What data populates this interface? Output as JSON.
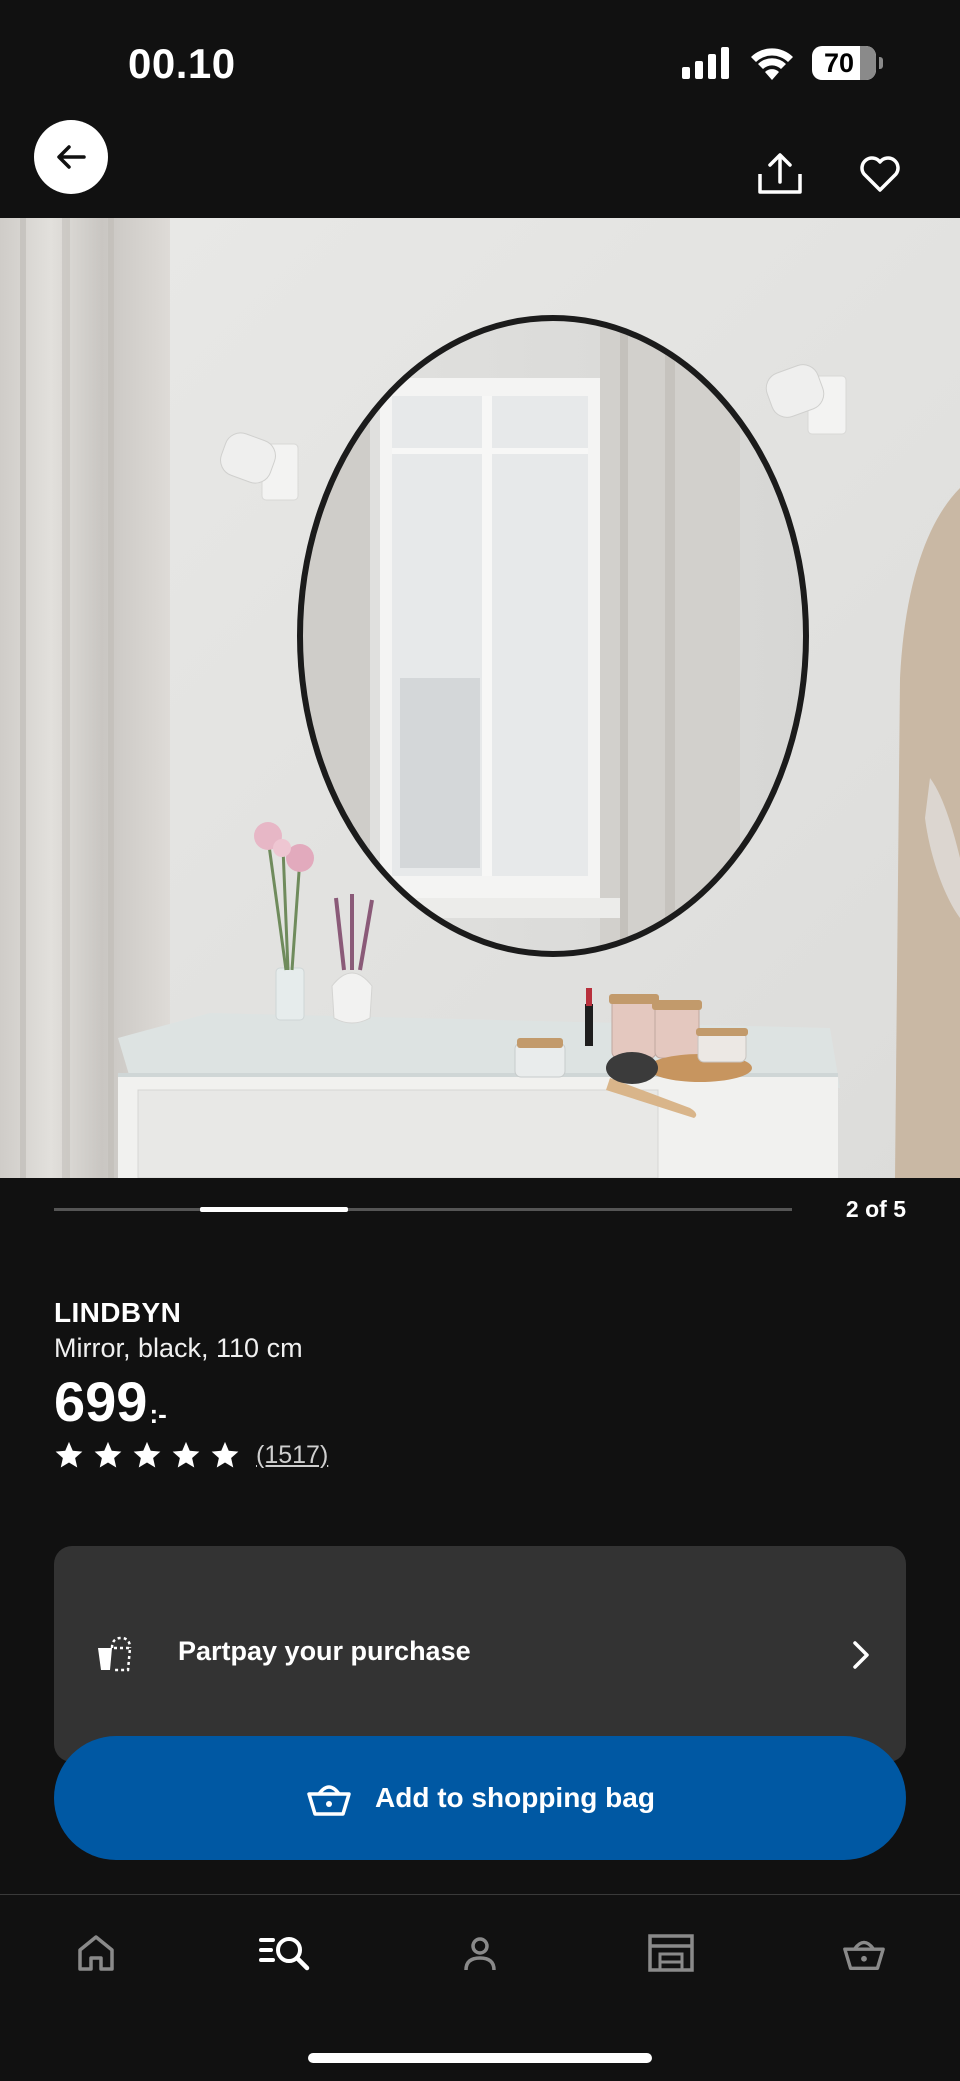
{
  "status_bar": {
    "time": "00.10",
    "battery": "70",
    "icons": [
      "cellular-signal-icon",
      "wifi-icon",
      "battery-icon"
    ]
  },
  "top_bar": {
    "icons": [
      "arrow-left-icon",
      "share-icon",
      "heart-icon"
    ]
  },
  "carousel": {
    "counter": "2 of 5",
    "current": 2,
    "total": 5
  },
  "product": {
    "name": "LINDBYN",
    "description": "Mirror, black, 110 cm",
    "price": "699",
    "price_suffix": ":-",
    "rating_stars": 5,
    "review_count": "(1517)"
  },
  "partpay": {
    "label": "Partpay your purchase",
    "icons": [
      "partpay-icon",
      "chevron-right-icon"
    ]
  },
  "add_to_bag": {
    "label": "Add to shopping bag",
    "icon": "shopping-basket-icon"
  },
  "tab_bar": {
    "tabs": [
      {
        "name": "home",
        "icon": "home-icon",
        "active": false
      },
      {
        "name": "search",
        "icon": "search-list-icon",
        "active": true
      },
      {
        "name": "profile",
        "icon": "person-icon",
        "active": false
      },
      {
        "name": "store",
        "icon": "store-icon",
        "active": false
      },
      {
        "name": "bag",
        "icon": "basket-icon",
        "active": false
      }
    ]
  },
  "colors": {
    "background": "#111111",
    "card": "#333333",
    "primary_button": "#0058a3",
    "text": "#ffffff"
  }
}
